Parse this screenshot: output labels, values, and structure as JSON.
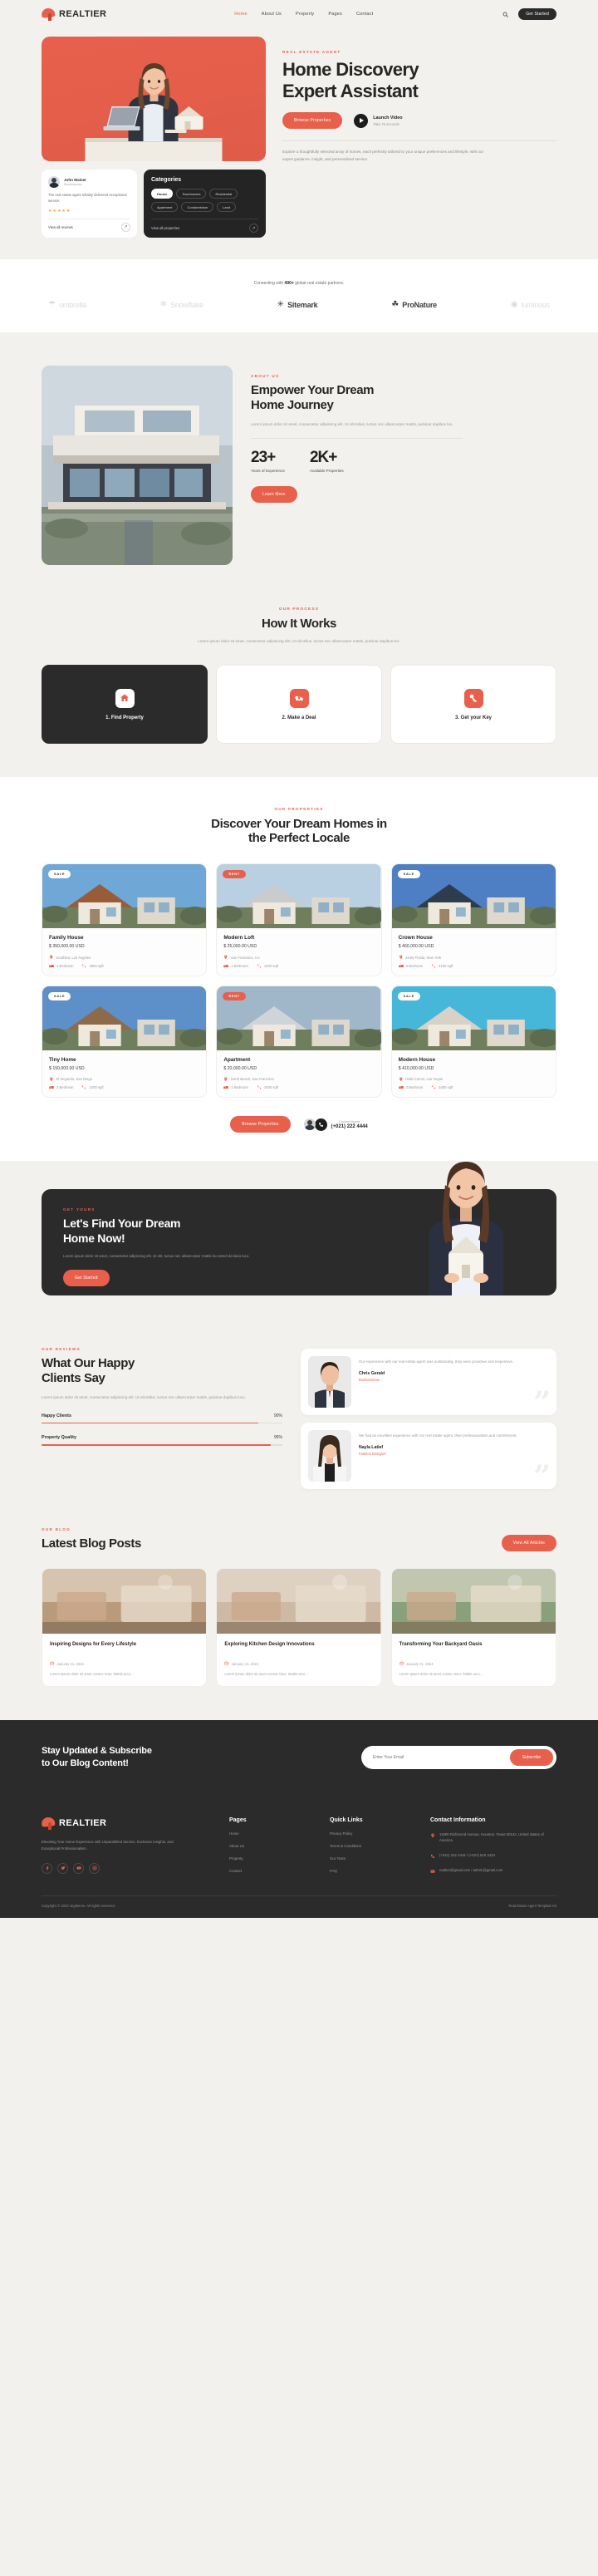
{
  "header": {
    "brand": "REALTIER",
    "nav": [
      {
        "label": "Home",
        "active": true
      },
      {
        "label": "About Us",
        "active": false
      },
      {
        "label": "Property",
        "active": false
      },
      {
        "label": "Pages",
        "active": false
      },
      {
        "label": "Contact",
        "active": false
      }
    ],
    "search_icon": "search-icon",
    "cta": "Get Started"
  },
  "hero": {
    "eyebrow": "REAL ESTATE AGENT",
    "title_line1": "Home Discovery",
    "title_line2": "Expert Assistant",
    "primary_btn": "Browse Properties",
    "video_title": "Launch Video",
    "video_sub": "Take 75 seconds",
    "description": "Explore a thoughtfully selected array of homes, each perfectly tailored to your unique preferences and lifestyle, with our expert guidance, insight, and personalized service.",
    "review_card": {
      "name": "John Mainer",
      "role": "Businessman",
      "text": "The real estate agent reliably delivered exceptional service.",
      "stars": "★★★★★",
      "link": "View all reviews"
    },
    "categories_card": {
      "title": "Categories",
      "chips": [
        {
          "label": "House",
          "active": true
        },
        {
          "label": "Townhouses",
          "active": false
        },
        {
          "label": "Residential",
          "active": false
        },
        {
          "label": "Apartment",
          "active": false
        },
        {
          "label": "Condominium",
          "active": false
        },
        {
          "label": "Land",
          "active": false
        }
      ],
      "link": "View all properties"
    }
  },
  "partners": {
    "lead_pre": "Connecting with ",
    "lead_bold": "400+",
    "lead_post": " global real estate partners.",
    "logos": [
      {
        "name": "umbrella",
        "glyph": "☂",
        "dark": false
      },
      {
        "name": "Snowflake",
        "glyph": "❄",
        "dark": false
      },
      {
        "name": "Sitemark",
        "glyph": "✳",
        "dark": true
      },
      {
        "name": "ProNature",
        "glyph": "☘",
        "dark": true
      },
      {
        "name": "luminous",
        "glyph": "◉",
        "dark": false
      }
    ]
  },
  "about": {
    "eyebrow": "ABOUT US",
    "title_line1": "Empower Your Dream",
    "title_line2": "Home Journey",
    "description": "Lorem ipsum dolor sit amet, consectetur adipiscing elit. Ut elit tellus, luctus nec ullamcorper mattis, pulvinar dapibus leo.",
    "stats": [
      {
        "value": "23+",
        "label": "Years of Experience"
      },
      {
        "value": "2K+",
        "label": "Available Properties"
      }
    ],
    "button": "Learn More"
  },
  "process": {
    "eyebrow": "OUR PROCESS",
    "title": "How It Works",
    "subtitle": "Lorem ipsum dolor sit amet, consectetur adipiscing elit. Ut elit tellus, luctus nec ullamcorper mattis, pulvinar dapibus leo.",
    "steps": [
      {
        "label": "1. Find Property",
        "icon": "house-icon",
        "active": true
      },
      {
        "label": "2. Make a Deal",
        "icon": "handshake-icon",
        "active": false
      },
      {
        "label": "3. Get your Key",
        "icon": "key-icon",
        "active": false
      }
    ]
  },
  "properties": {
    "eyebrow": "OUR PROPERTIES",
    "title_line1": "Discover Your Dream Homes in",
    "title_line2": "the Perfect Locale",
    "cards": [
      {
        "tag": "SALE",
        "tag_type": "sale",
        "title": "Family House",
        "price": "$ 350,000.00 USD",
        "location": "Southlea, Los Angeles",
        "bedrooms": "3 Bedroom",
        "area": "3800 sqft",
        "sky": "#6fa8d6",
        "roof": "#9a5b3a"
      },
      {
        "tag": "RENT",
        "tag_type": "rent",
        "title": "Modern Loft",
        "price": "$ 25,000.00 USD",
        "location": "San Francisco, CA",
        "bedrooms": "2 Bedroom",
        "area": "1200 sqft",
        "sky": "#b9cfe2",
        "roof": "#c9cbcc"
      },
      {
        "tag": "SALE",
        "tag_type": "sale",
        "title": "Crown House",
        "price": "$ 460,000.00 USD",
        "location": "Smity Fielda, New York",
        "bedrooms": "3 Bedroom",
        "area": "4100 sqft",
        "sky": "#4e7fc4",
        "roof": "#2f3c4c"
      },
      {
        "tag": "SALE",
        "tag_type": "sale",
        "title": "Tiny Home",
        "price": "$ 150,000.00 USD",
        "location": "El Segundo, San Diego",
        "bedrooms": "3 Bedroom",
        "area": "2200 sqft",
        "sky": "#5d8fc9",
        "roof": "#8f6a4a"
      },
      {
        "tag": "RENT",
        "tag_type": "rent",
        "title": "Apartment",
        "price": "$ 20,000.00 USD",
        "location": "North Beach, San Francisco",
        "bedrooms": "1 Bedroom",
        "area": "1000 sqft",
        "sky": "#9fb7c9",
        "roof": "#cfd4d8"
      },
      {
        "tag": "SALE",
        "tag_type": "sale",
        "title": "Modern House",
        "price": "$ 410,000.00 USD",
        "location": "Halls Corner, Las Vegas",
        "bedrooms": "3 Bedroom",
        "area": "3400 sqft",
        "sky": "#46b6d9",
        "roof": "#d8d2c6"
      }
    ],
    "browse_btn": "Browse Properties",
    "agent_label": "Contact Agent",
    "agent_phone": "(+021) 222 4444"
  },
  "cta": {
    "eyebrow": "GET YOURS",
    "title_line1": "Let's Find Your Dream",
    "title_line2": "Home Now!",
    "description": "Lorem ipsum dolor sit amet, consectetur adipiscing elit. Ut elit, luctus nec ullamcorper mattis leo tamel da liaso luco.",
    "button": "Get Started"
  },
  "reviews": {
    "eyebrow": "OUR REVIEWS",
    "title_line1": "What Our Happy",
    "title_line2": "Clients Say",
    "description": "Lorem ipsum dolor sit amet, consectetur adipiscing elit. Ut elit tellus, luctus nec ullamcorper mattis, pulvinar dapibus luco.",
    "bars": [
      {
        "label": "Happy Clients",
        "value": "90%",
        "pct": 90
      },
      {
        "label": "Property Quality",
        "value": "95%",
        "pct": 95
      }
    ],
    "testimonials": [
      {
        "quote": "Our experience with our real estate agent was outstanding, they were proactive and responsive.",
        "name": "Chris Gerald",
        "role": "Businessman"
      },
      {
        "quote": "We had an excellent experience with our real estate agent, their professionalism and commitment.",
        "name": "Nayla Latief",
        "role": "Fashion Designer"
      }
    ]
  },
  "blog": {
    "eyebrow": "OUR BLOG",
    "title": "Latest Blog Posts",
    "view_all": "View All Articles",
    "posts": [
      {
        "title": "Inspiring Designs for Every Lifestyle",
        "date": "January 21, 2024",
        "excerpt": "Lorem ipsum dolor sit amet consec tetur. Mattis arcu...",
        "hue": "#b99b7c"
      },
      {
        "title": "Exploring Kitchen Design Innovations",
        "date": "January 21, 2024",
        "excerpt": "Lorem ipsum dolor sit amet consec tetur. Mattis arcu...",
        "hue": "#cdb9a4"
      },
      {
        "title": "Transforming Your Backyard Oasis",
        "date": "January 21, 2024",
        "excerpt": "Lorem ipsum dolor sit amet consec tetur. Mattis arcu...",
        "hue": "#8aa07a"
      }
    ]
  },
  "subscribe": {
    "title_line1": "Stay Updated & Subscribe",
    "title_line2": "to Our Blog Content!",
    "placeholder": "Enter Your Email",
    "button": "Subscribe"
  },
  "footer": {
    "brand": "REALTIER",
    "description": "Elevating Your Home Experience with Unparalleled Service, Exclusive Insights, and Exceptional Professionalism.",
    "socials": [
      "facebook-icon",
      "twitter-icon",
      "youtube-icon",
      "instagram-icon"
    ],
    "columns": [
      {
        "heading": "Pages",
        "items": [
          "Home",
          "About Us",
          "Property",
          "Contact"
        ]
      },
      {
        "heading": "Quick Links",
        "items": [
          "Privacy Policy",
          "Terms & Conditions",
          "Our Team",
          "FAQ"
        ]
      }
    ],
    "contact_heading": "Contact Information",
    "contact": [
      {
        "icon": "pin-icon",
        "text": "11900 Richmond Avenue, Houston, Texas 60142, United States of America"
      },
      {
        "icon": "phone-icon",
        "text": "(+021) 222 4444 / (+021) 515 3434"
      },
      {
        "icon": "mail-icon",
        "text": "realtier@gmail.com / admin@gmail.com"
      }
    ],
    "copyright": "Copyright © 2024 Jegtheme. All rights reserved.",
    "tagline": "Real Estate Agent Template Kit"
  },
  "colors": {
    "accent": "#e8604c",
    "dark": "#2b2b2b",
    "bg": "#f2f1ed"
  }
}
